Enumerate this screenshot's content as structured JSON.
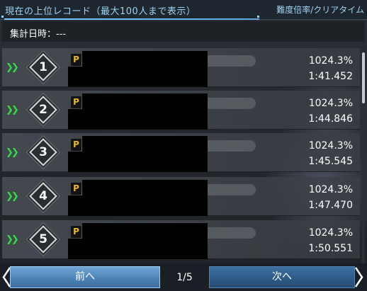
{
  "header": {
    "title": "現在の上位レコード（最大100人まで表示）",
    "sort_label": "難度倍率/クリアタイム"
  },
  "aggregate": {
    "label": "集計日時：---"
  },
  "rows": [
    {
      "rank": "1",
      "badge": "P",
      "ratio": "1024.3%",
      "time": "1:41.452"
    },
    {
      "rank": "2",
      "badge": "P",
      "ratio": "1024.3%",
      "time": "1:44.846"
    },
    {
      "rank": "3",
      "badge": "P",
      "ratio": "1024.3%",
      "time": "1:45.545"
    },
    {
      "rank": "4",
      "badge": "P",
      "ratio": "1024.3%",
      "time": "1:47.470"
    },
    {
      "rank": "5",
      "badge": "P",
      "ratio": "1024.3%",
      "time": "1:50.551"
    }
  ],
  "footer": {
    "prev_label": "前へ",
    "next_label": "次へ",
    "page_indicator": "1/5"
  },
  "colors": {
    "accent": "#9fd2f2",
    "arrow": "#33dd44",
    "badge": "#e8b91a"
  }
}
